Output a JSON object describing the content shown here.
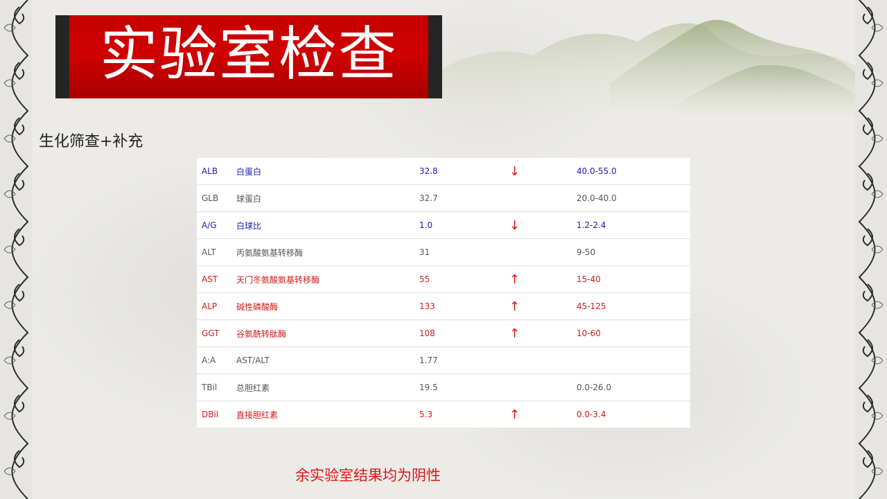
{
  "slide": {
    "title": "实验室检查",
    "subtitle": "生化筛查+补充",
    "footer_note": "余实验室结果均为阴性"
  },
  "lab_results": [
    {
      "code": "ALB",
      "name": "白蛋白",
      "value": "32.8",
      "flag": "↓",
      "range": "40.0-55.0",
      "style": "blue"
    },
    {
      "code": "GLB",
      "name": "球蛋白",
      "value": "32.7",
      "flag": "",
      "range": "20.0-40.0",
      "style": "normal"
    },
    {
      "code": "A/G",
      "name": "白球比",
      "value": "1.0",
      "flag": "↓",
      "range": "1.2-2.4",
      "style": "blue"
    },
    {
      "code": "ALT",
      "name": "丙氨酸氨基转移酶",
      "value": "31",
      "flag": "",
      "range": "9-50",
      "style": "normal"
    },
    {
      "code": "AST",
      "name": "天门冬氨酸氨基转移酶",
      "value": "55",
      "flag": "↑",
      "range": "15-40",
      "style": "red"
    },
    {
      "code": "ALP",
      "name": "碱性磷酸酶",
      "value": "133",
      "flag": "↑",
      "range": "45-125",
      "style": "red"
    },
    {
      "code": "GGT",
      "name": "谷氨酰转肽酶",
      "value": "108",
      "flag": "↑",
      "range": "10-60",
      "style": "red"
    },
    {
      "code": "A:A",
      "name": "AST/ALT",
      "value": "1.77",
      "flag": "",
      "range": "",
      "style": "normal"
    },
    {
      "code": "TBil",
      "name": "总胆红素",
      "value": "19.5",
      "flag": "",
      "range": "0.0-26.0",
      "style": "normal"
    },
    {
      "code": "DBil",
      "name": "直接胆红素",
      "value": "5.3",
      "flag": "↑",
      "range": "0.0-3.4",
      "style": "red"
    }
  ],
  "colors": {
    "banner_red": "#c40000",
    "banner_cap": "#252525",
    "flag_red": "#e01010",
    "row_blue": "#1a1ab0",
    "row_red": "#d11a1a",
    "row_normal": "#555555"
  },
  "decorations": {
    "side_borders": "wave-pattern",
    "top_right": "ink-mountains"
  }
}
